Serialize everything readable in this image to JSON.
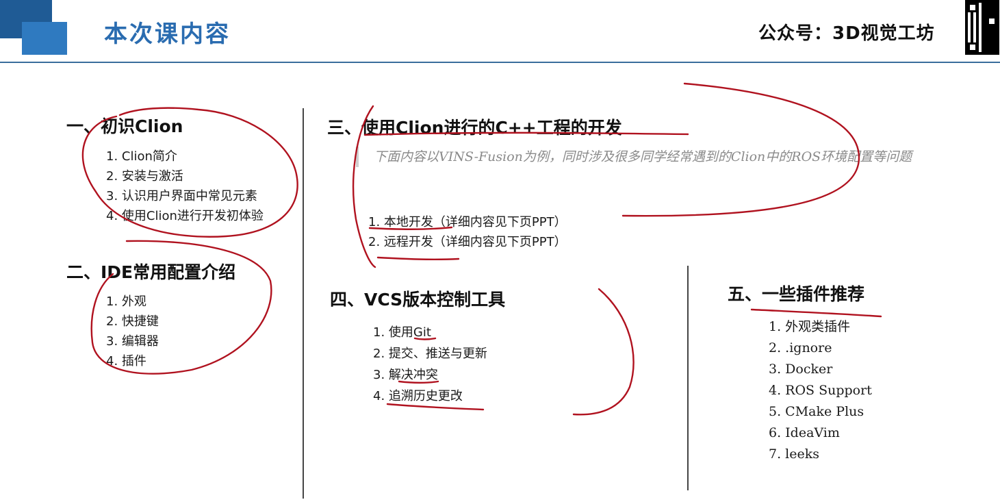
{
  "header": {
    "title": "本次课内容",
    "brand": "公众号：3D视觉工坊"
  },
  "section1": {
    "title": "一、初识Clion",
    "items": [
      "1. Clion简介",
      "2. 安装与激活",
      "3. 认识用户界面中常见元素",
      "4. 使用Clion进行开发初体验"
    ]
  },
  "section2": {
    "title": "二、IDE常用配置介绍",
    "items": [
      "1. 外观",
      "2. 快捷键",
      "3. 编辑器",
      "4. 插件"
    ]
  },
  "section3": {
    "title": "三、使用Clion进行的C++工程的开发",
    "note": "下面内容以VINS-Fusion为例，同时涉及很多同学经常遇到的Clion中的ROS环境配置等问题",
    "items": [
      "1. 本地开发（详细内容见下页PPT）",
      "2. 远程开发（详细内容见下页PPT）"
    ]
  },
  "section4": {
    "title": "四、VCS版本控制工具",
    "items": [
      "1. 使用Git",
      "2. 提交、推送与更新",
      "3. 解决冲突",
      "4. 追溯历史更改"
    ]
  },
  "section5": {
    "title": "五、一些插件推荐",
    "items": [
      "1. 外观类插件",
      "2. .ignore",
      "3. Docker",
      "4. ROS Support",
      "5. CMake Plus",
      "6. IdeaVim",
      "7. leeks"
    ]
  },
  "colors": {
    "accent": "#2a6cb0",
    "annotation": "#b0121f"
  }
}
